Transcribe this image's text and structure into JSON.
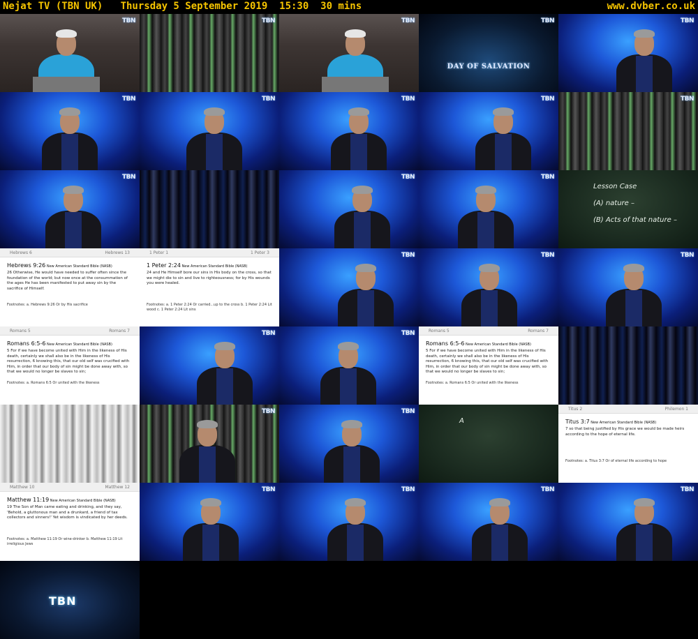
{
  "header": {
    "title": "Nejat TV (TBN UK)   Thursday 5 September 2019  15:30  30 mins",
    "site": "www.dvber.co.uk"
  },
  "colors": {
    "header_text": "#f5c400",
    "background": "#000000"
  },
  "tbn_bug": "TBN",
  "thumbnails": [
    {
      "type": "grey-presenter"
    },
    {
      "type": "strobe"
    },
    {
      "type": "grey-presenter"
    },
    {
      "type": "salvation",
      "caption": "DAY OF SALVATION"
    },
    {
      "type": "presenter"
    },
    {
      "type": "presenter"
    },
    {
      "type": "presenter"
    },
    {
      "type": "presenter"
    },
    {
      "type": "presenter"
    },
    {
      "type": "strobe"
    },
    {
      "type": "presenter"
    },
    {
      "type": "strobe-dark"
    },
    {
      "type": "presenter"
    },
    {
      "type": "presenter"
    },
    {
      "type": "chalk",
      "lines": [
        "Lesson Case",
        "(A) nature –",
        "(B) Acts of that nature –"
      ]
    },
    {
      "type": "doc",
      "left": "Hebrews 6",
      "right": "Hebrews 13",
      "ref": "Hebrews 9:26",
      "version": "New American Standard Bible (NASB)",
      "text": "26 Otherwise, He would have needed to suffer often since the foundation of the world; but now once at the consummation of the ages He has been manifested to put away sin by the sacrifice of Himself.",
      "fn": "Footnotes: a. Hebrews 9:26 Or by His sacrifice"
    },
    {
      "type": "doc",
      "left": "1 Peter 1",
      "right": "1 Peter 3",
      "ref": "1 Peter 2:24",
      "version": "New American Standard Bible (NASB)",
      "text": "24 and He Himself bore our sins in His body on the cross, so that we might die to sin and live to righteousness; for by His wounds you were healed.",
      "fn": "Footnotes: a. 1 Peter 2:24 Or carried...up to the cross  b. 1 Peter 2:24 Lit wood  c. 1 Peter 2:24 Lit sins"
    },
    {
      "type": "presenter"
    },
    {
      "type": "presenter"
    },
    {
      "type": "presenter"
    },
    {
      "type": "doc",
      "left": "Romans 5",
      "right": "Romans 7",
      "ref": "Romans 6:5-6",
      "version": "New American Standard Bible (NASB)",
      "text": "5 For if we have become united with Him in the likeness of His death, certainly we shall also be in the likeness of His resurrection, 6 knowing this, that our old self was crucified with Him, in order that our body of sin might be done away with, so that we would no longer be slaves to sin;",
      "fn": "Footnotes: a. Romans 6:5 Or united with the likeness"
    },
    {
      "type": "presenter"
    },
    {
      "type": "presenter"
    },
    {
      "type": "doc",
      "left": "Romans 5",
      "right": "Romans 7",
      "ref": "Romans 6:5-6",
      "version": "New American Standard Bible (NASB)",
      "text": "5 For if we have become united with Him in the likeness of His death, certainly we shall also be in the likeness of His resurrection, 6 knowing this, that our old self was crucified with Him, in order that our body of sin might be done away with, so that we would no longer be slaves to sin;",
      "fn": "Footnotes: a. Romans 6:5 Or united with the likeness"
    },
    {
      "type": "strobe-dark"
    },
    {
      "type": "strobe-light"
    },
    {
      "type": "strobe-presenter"
    },
    {
      "type": "presenter"
    },
    {
      "type": "chalk",
      "lines": [
        "A"
      ]
    },
    {
      "type": "doc",
      "left": "Titus 2",
      "right": "Philemon 1",
      "ref": "Titus 3:7",
      "version": "New American Standard Bible (NASB)",
      "text": "7 so that being justified by His grace we would be made heirs according to the hope of eternal life.",
      "fn": "Footnotes: a. Titus 3:7 Or of eternal life according to hope"
    },
    {
      "type": "doc",
      "left": "Matthew 10",
      "right": "Matthew 12",
      "ref": "Matthew 11:19",
      "version": "New American Standard Bible (NASB)",
      "text": "19 The Son of Man came eating and drinking, and they say, 'Behold, a gluttonous man and a drunkard, a friend of tax collectors and sinners!' Yet wisdom is vindicated by her deeds.",
      "fn": "Footnotes: a. Matthew 11:19 Or wine-drinker  b. Matthew 11:19 Lit irreligious Jews"
    },
    {
      "type": "presenter"
    },
    {
      "type": "presenter"
    },
    {
      "type": "presenter"
    },
    {
      "type": "presenter"
    },
    {
      "type": "logo",
      "caption": "TBN"
    }
  ]
}
